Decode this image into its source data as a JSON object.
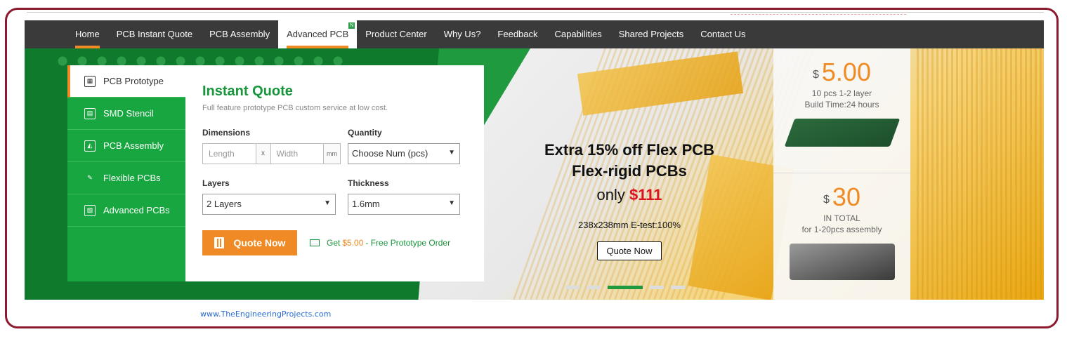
{
  "nav": {
    "items": [
      {
        "label": "Home"
      },
      {
        "label": "PCB Instant Quote"
      },
      {
        "label": "PCB Assembly"
      },
      {
        "label": "Advanced PCB"
      },
      {
        "label": "Product Center"
      },
      {
        "label": "Why Us?"
      },
      {
        "label": "Feedback"
      },
      {
        "label": "Capabilities"
      },
      {
        "label": "Shared Projects"
      },
      {
        "label": "Contact Us"
      }
    ]
  },
  "sidebar": {
    "items": [
      {
        "label": "PCB Prototype",
        "icon": "pcb-chip-icon"
      },
      {
        "label": "SMD Stencil",
        "icon": "stencil-icon"
      },
      {
        "label": "PCB Assembly",
        "icon": "assembly-icon"
      },
      {
        "label": "Flexible PCBs",
        "icon": "flex-icon"
      },
      {
        "label": "Advanced PCBs",
        "icon": "advanced-icon"
      }
    ]
  },
  "quote": {
    "title": "Instant Quote",
    "subtitle": "Full feature prototype PCB custom service at low cost.",
    "dimensions_label": "Dimensions",
    "length_placeholder": "Length",
    "x_label": "x",
    "width_placeholder": "Width",
    "unit": "mm",
    "quantity_label": "Quantity",
    "quantity_value": "Choose Num (pcs)",
    "layers_label": "Layers",
    "layers_value": "2 Layers",
    "thickness_label": "Thickness",
    "thickness_value": "1.6mm",
    "quote_button": "Quote Now",
    "promo_prefix": "Get",
    "promo_amount": "$5.00",
    "promo_suffix": "- Free Prototype Order"
  },
  "hero": {
    "line1": "Extra 15% off Flex PCB",
    "line2": "Flex-rigid PCBs",
    "line3_prefix": "only",
    "line3_price": "$111",
    "line4": "238x238mm E-test:100%",
    "button": "Quote Now",
    "slides": 5,
    "active_slide": 3
  },
  "promos": [
    {
      "currency": "$",
      "price": "5.00",
      "line1": "10 pcs 1-2 layer",
      "line2": "Build Time:24 hours"
    },
    {
      "currency": "$",
      "price": "30",
      "line1": "IN TOTAL",
      "line2": "for 1-20pcs assembly"
    }
  ],
  "footer": {
    "url": "www.TheEngineeringProjects.com"
  },
  "colors": {
    "accent": "#f08a24",
    "brand_green": "#17a63f",
    "nav_bg": "#3a3a3a",
    "price_red": "#d9141e",
    "frame": "#8b1a2e"
  }
}
